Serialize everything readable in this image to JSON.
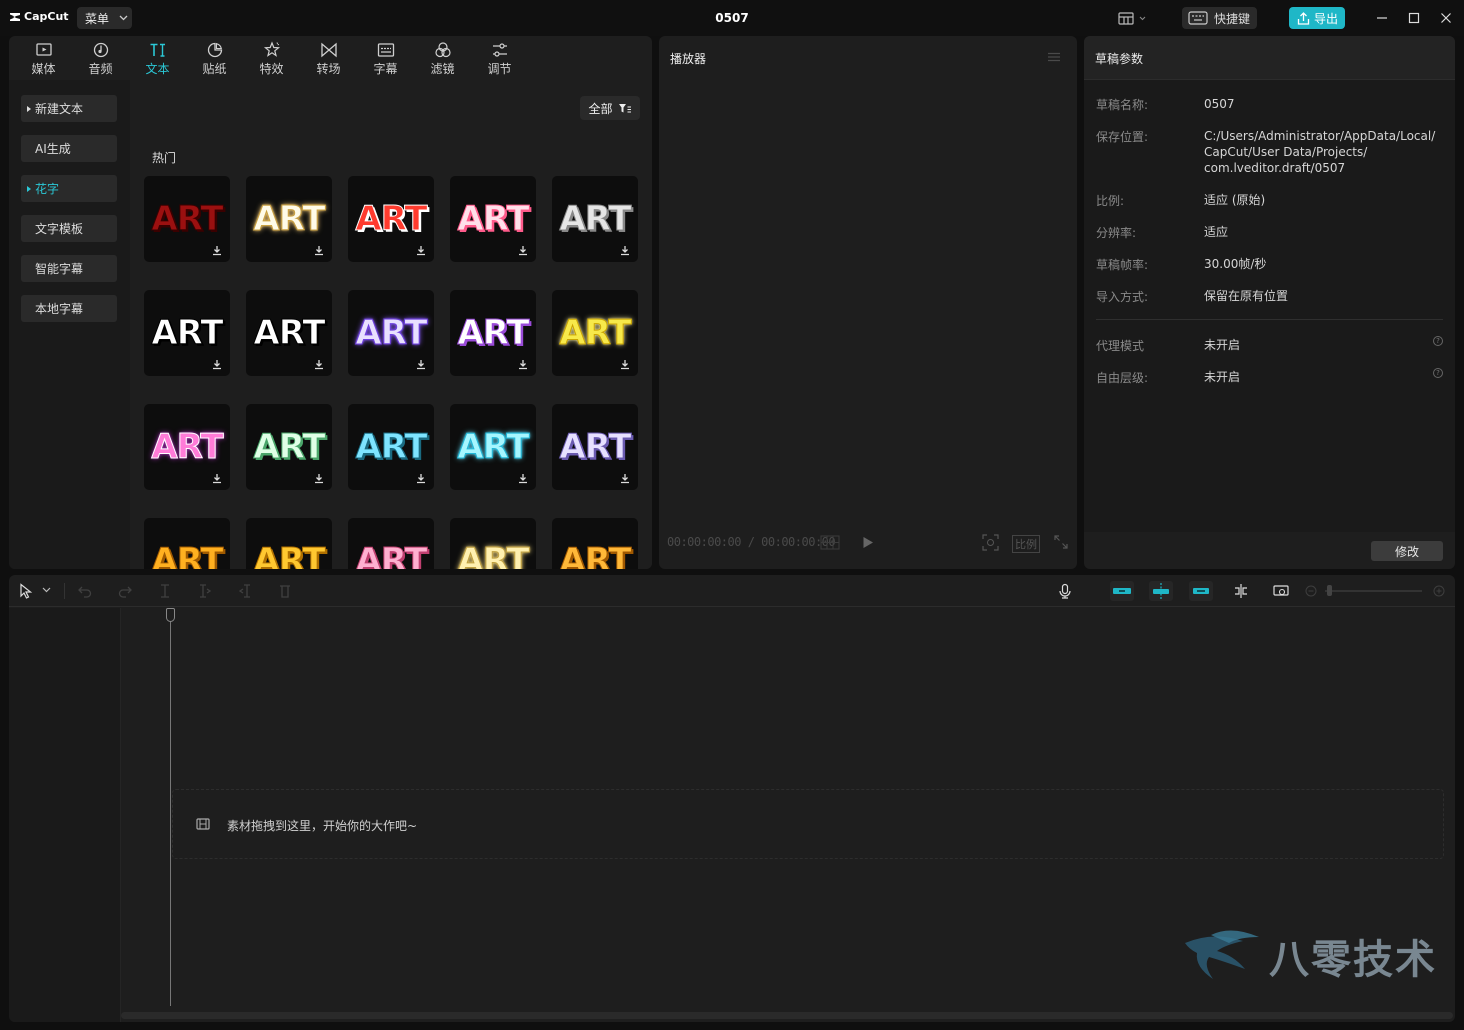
{
  "app": {
    "logo_text": "CapCut",
    "menu_label": "菜单",
    "project_title": "0507",
    "shortcut_label": "快捷键",
    "export_label": "导出",
    "accent_color": "#1fb7c7"
  },
  "tool_tabs": [
    {
      "label": "媒体",
      "icon": "media-icon"
    },
    {
      "label": "音频",
      "icon": "audio-icon"
    },
    {
      "label": "文本",
      "icon": "text-icon",
      "active": true
    },
    {
      "label": "贴纸",
      "icon": "sticker-icon"
    },
    {
      "label": "特效",
      "icon": "effects-icon"
    },
    {
      "label": "转场",
      "icon": "transition-icon"
    },
    {
      "label": "字幕",
      "icon": "subtitle-icon"
    },
    {
      "label": "滤镜",
      "icon": "filter-icon"
    },
    {
      "label": "调节",
      "icon": "adjust-icon"
    }
  ],
  "text_categories": [
    {
      "label": "新建文本",
      "arrow": true
    },
    {
      "label": "AI生成",
      "arrow": false
    },
    {
      "label": "花字",
      "arrow": true,
      "active": true
    },
    {
      "label": "文字模板",
      "arrow": false
    },
    {
      "label": "智能字幕",
      "arrow": false
    },
    {
      "label": "本地字幕",
      "arrow": false
    }
  ],
  "library": {
    "filter_label": "全部",
    "section_label": "热门",
    "tile_text": "ART",
    "tiles": [
      {
        "fill": "#9b1010",
        "stroke": "#3a0000",
        "glow": "none"
      },
      {
        "fill": "#fffbe8",
        "stroke": "#c9a040",
        "glow": "#ffd27a"
      },
      {
        "fill": "#ff3b2e",
        "stroke": "#ffffff",
        "glow": "none"
      },
      {
        "fill": "#ffe0ea",
        "stroke": "#ff5b8b",
        "glow": "none"
      },
      {
        "fill": "#e6e6e6",
        "stroke": "#888888",
        "glow": "none"
      },
      {
        "fill": "#ffffff",
        "stroke": "#000000",
        "glow": "none"
      },
      {
        "fill": "#ffffff",
        "stroke": "#000000",
        "glow": "none"
      },
      {
        "fill": "#e8e0ff",
        "stroke": "#6e3fe0",
        "glow": "#8b5cff"
      },
      {
        "fill": "#ffffff",
        "stroke": "#9a4bd8",
        "glow": "none"
      },
      {
        "fill": "#f7e94a",
        "stroke": "#c9a400",
        "glow": "#fff1a0"
      },
      {
        "fill": "#ff7bd8",
        "stroke": "#ffffff",
        "glow": "#b030c0"
      },
      {
        "fill": "#dfffe6",
        "stroke": "#4aa66a",
        "glow": "none"
      },
      {
        "fill": "#7ee4ff",
        "stroke": "#1a6a80",
        "glow": "none"
      },
      {
        "fill": "#a6f6ff",
        "stroke": "#20b8d8",
        "glow": "#5fe0ff"
      },
      {
        "fill": "#e6e0ff",
        "stroke": "#6a5ab0",
        "glow": "none"
      },
      {
        "fill": "#ffb020",
        "stroke": "#a05a00",
        "glow": "none"
      },
      {
        "fill": "#ffc830",
        "stroke": "#b07000",
        "glow": "none"
      },
      {
        "fill": "#ffb0d0",
        "stroke": "#c04070",
        "glow": "none"
      },
      {
        "fill": "#fff0b0",
        "stroke": "#c0a040",
        "glow": "#ffe080"
      },
      {
        "fill": "#ffb838",
        "stroke": "#a05800",
        "glow": "none"
      }
    ]
  },
  "player": {
    "title": "播放器",
    "timecode": "00:00:00:00 / 00:00:00:00",
    "ratio_label": "比例"
  },
  "draft": {
    "title": "草稿参数",
    "props": [
      {
        "label": "草稿名称:",
        "value": "0507"
      },
      {
        "label": "保存位置:",
        "value_lines": [
          "C:/Users/Administrator/AppData/Local/",
          "CapCut/User Data/Projects/",
          "com.lveditor.draft/0507"
        ]
      },
      {
        "label": "比例:",
        "value": "适应 (原始)"
      },
      {
        "label": "分辨率:",
        "value": "适应"
      },
      {
        "label": "草稿帧率:",
        "value": "30.00帧/秒"
      },
      {
        "label": "导入方式:",
        "value": "保留在原有位置"
      }
    ],
    "extra_props": [
      {
        "label": "代理模式",
        "value": "未开启"
      },
      {
        "label": "自由层级:",
        "value": "未开启"
      }
    ],
    "modify_label": "修改"
  },
  "timeline": {
    "drop_hint": "素材拖拽到这里，开始你的大作吧~"
  },
  "watermark": {
    "text": "八零技术"
  }
}
